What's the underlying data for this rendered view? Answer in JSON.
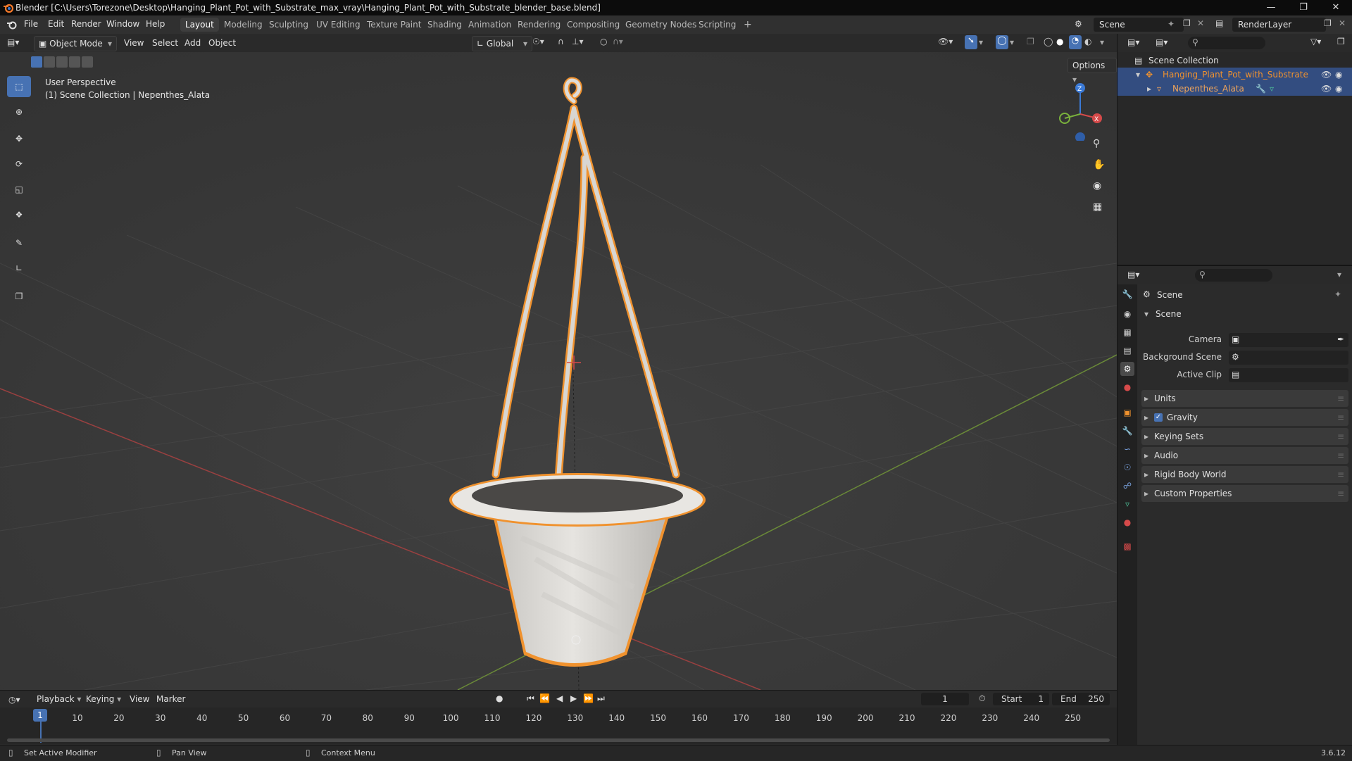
{
  "window": {
    "title": "Blender [C:\\Users\\Torezone\\Desktop\\Hanging_Plant_Pot_with_Substrate_max_vray\\Hanging_Plant_Pot_with_Substrate_blender_base.blend]",
    "controls": [
      "—",
      "❐",
      "✕"
    ]
  },
  "menubar": {
    "items": [
      "File",
      "Edit",
      "Render",
      "Window",
      "Help"
    ],
    "workspaces": [
      "Layout",
      "Modeling",
      "Sculpting",
      "UV Editing",
      "Texture Paint",
      "Shading",
      "Animation",
      "Rendering",
      "Compositing",
      "Geometry Nodes",
      "Scripting"
    ],
    "active_workspace": "Layout",
    "add_tab": "+",
    "scene_name": "Scene",
    "view_layer_name": "RenderLayer"
  },
  "viewport_header": {
    "mode": "Object Mode",
    "menus": [
      "View",
      "Select",
      "Add",
      "Object"
    ],
    "transform_orientation": "Global",
    "options_label": "Options"
  },
  "viewport": {
    "perspective_label": "User Perspective",
    "collection_label": "(1) Scene Collection | Nepenthes_Alata",
    "gizmo_axes": {
      "z": "Z",
      "x": "X"
    },
    "accent_colors": {
      "selection": "#f0922e",
      "axis_x": "#d64a4a",
      "axis_y": "#7ab23c",
      "axis_z": "#3b7ad6"
    }
  },
  "outliner": {
    "root": "Scene Collection",
    "rows": [
      {
        "name": "Hanging_Plant_Pot_with_Substrate",
        "color": "#f0922e"
      },
      {
        "name": "Nepenthes_Alata",
        "color": "#f0a45a"
      }
    ]
  },
  "properties": {
    "header": "Scene",
    "section": "Scene",
    "fields": [
      {
        "label": "Camera"
      },
      {
        "label": "Background Scene"
      },
      {
        "label": "Active Clip"
      }
    ],
    "panels": [
      {
        "label": "Units",
        "checkbox": false
      },
      {
        "label": "Gravity",
        "checkbox": true
      },
      {
        "label": "Keying Sets",
        "checkbox": false
      },
      {
        "label": "Audio",
        "checkbox": false
      },
      {
        "label": "Rigid Body World",
        "checkbox": false
      },
      {
        "label": "Custom Properties",
        "checkbox": false
      }
    ]
  },
  "timeline": {
    "menus": [
      "Playback",
      "Keying",
      "View",
      "Marker"
    ],
    "current_frame": "1",
    "start_label": "Start",
    "start_value": "1",
    "end_label": "End",
    "end_value": "250",
    "ticks": [
      "10",
      "20",
      "30",
      "40",
      "50",
      "60",
      "70",
      "80",
      "90",
      "100",
      "110",
      "120",
      "130",
      "140",
      "150",
      "160",
      "170",
      "180",
      "190",
      "200",
      "210",
      "220",
      "230",
      "240",
      "250"
    ],
    "playhead_label": "1"
  },
  "statusbar": {
    "items": [
      "Set Active Modifier",
      "Pan View",
      "Context Menu"
    ],
    "version": "3.6.12"
  }
}
